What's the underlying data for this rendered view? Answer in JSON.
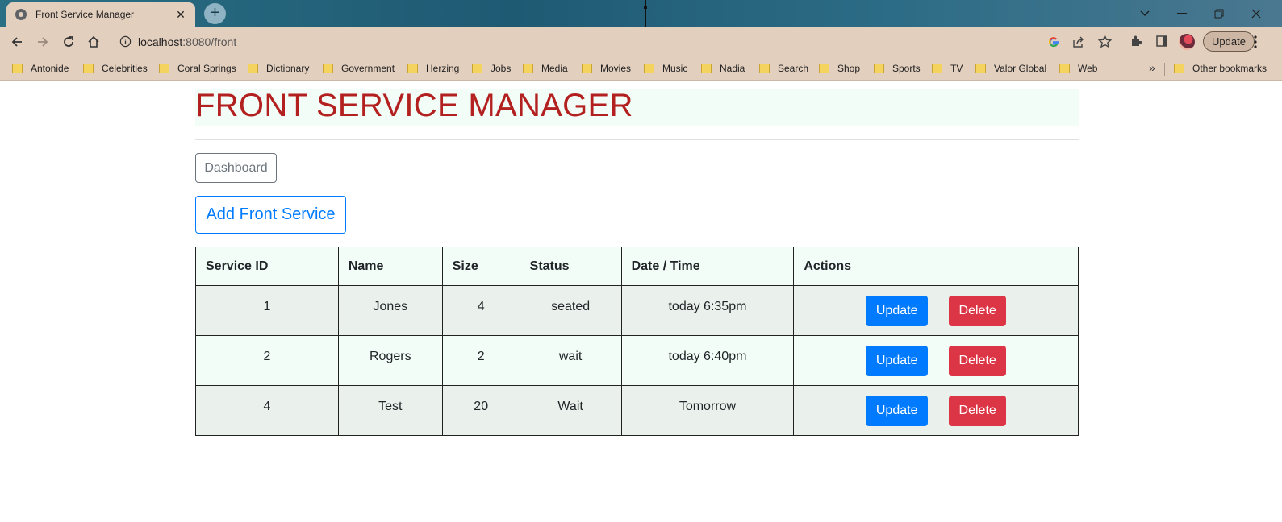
{
  "browser": {
    "tab_title": "Front Service Manager",
    "url_host": "localhost",
    "url_rest": ":8080/front",
    "update_label": "Update",
    "bookmarks": [
      "Antonide",
      "Celebrities",
      "Coral Springs",
      "Dictionary",
      "Government",
      "Herzing",
      "Jobs",
      "Media",
      "Movies",
      "Music",
      "Nadia",
      "Search",
      "Shop",
      "Sports",
      "TV",
      "Valor Global",
      "Web"
    ],
    "other_bookmarks": "Other bookmarks",
    "overflow_glyph": "»",
    "new_tab_glyph": "+",
    "close_glyph": "✕"
  },
  "page": {
    "title": "FRONT SERVICE MANAGER",
    "dashboard_label": "Dashboard",
    "add_label": "Add Front Service",
    "title_color": "#b32020"
  },
  "table": {
    "headers": [
      "Service ID",
      "Name",
      "Size",
      "Status",
      "Date / Time",
      "Actions"
    ],
    "rows": [
      {
        "id": "1",
        "name": "Jones",
        "size": "4",
        "status": "seated",
        "datetime": "today 6:35pm"
      },
      {
        "id": "2",
        "name": "Rogers",
        "size": "2",
        "status": "wait",
        "datetime": "today 6:40pm"
      },
      {
        "id": "4",
        "name": "Test",
        "size": "20",
        "status": "Wait",
        "datetime": "Tomorrow"
      }
    ],
    "update_label": "Update",
    "delete_label": "Delete"
  },
  "colors": {
    "primary": "#007bff",
    "danger": "#dc3545",
    "secondary": "#6c757d",
    "chrome": "#e3cfbe"
  }
}
